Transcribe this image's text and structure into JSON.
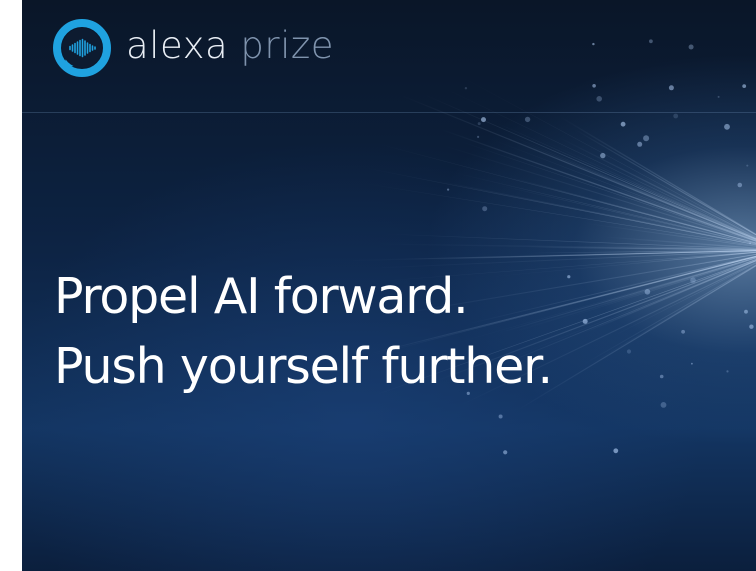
{
  "brand": {
    "name_first": "alexa",
    "name_second": "prize",
    "logo_icon": "alexa-speech-bubble-soundwave-icon",
    "accent_color": "#1fa2e0"
  },
  "hero": {
    "line1": "Propel AI forward.",
    "line2": "Push yourself further."
  },
  "colors": {
    "background_dark": "#0a1628",
    "background_mid": "#133562",
    "headline": "#ffffff",
    "brand_word_primary": "#e9eef5",
    "brand_word_secondary": "#7f93ad"
  }
}
